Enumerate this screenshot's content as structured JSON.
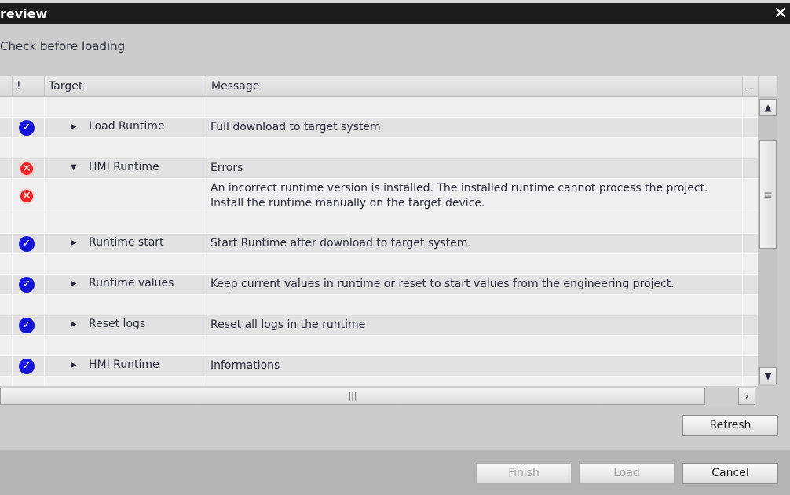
{
  "window": {
    "title": "review",
    "close": "✕"
  },
  "subtitle": "Check before loading",
  "table": {
    "headers": {
      "status": "!",
      "target": "Target",
      "message": "Message",
      "more": "..."
    },
    "rows": [
      {
        "status": "ok",
        "expander": "right",
        "target": "Load Runtime",
        "message": "Full download to target system"
      },
      {
        "status": "error",
        "expander": "down",
        "target": "HMI Runtime",
        "message": "Errors"
      },
      {
        "status": "error",
        "expander": "",
        "target": "",
        "message": "An incorrect runtime version is installed. The installed runtime cannot process the project.",
        "message2": "Install the runtime manually on the target device."
      },
      {
        "status": "ok",
        "expander": "right",
        "target": "Runtime start",
        "message": "Start Runtime after download to target system."
      },
      {
        "status": "ok",
        "expander": "right",
        "target": "Runtime values",
        "message": "Keep current values in runtime or reset to start values from the engineering project."
      },
      {
        "status": "ok",
        "expander": "right",
        "target": "Reset logs",
        "message": "Reset all logs in the runtime"
      },
      {
        "status": "ok",
        "expander": "right",
        "target": "HMI Runtime",
        "message": "Informations"
      }
    ]
  },
  "buttons": {
    "refresh": "Refresh",
    "finish": "Finish",
    "load": "Load",
    "cancel": "Cancel"
  },
  "colors": {
    "ok": "#1515d8",
    "error": "#e22222",
    "titlebar": "#1c1c1c"
  }
}
